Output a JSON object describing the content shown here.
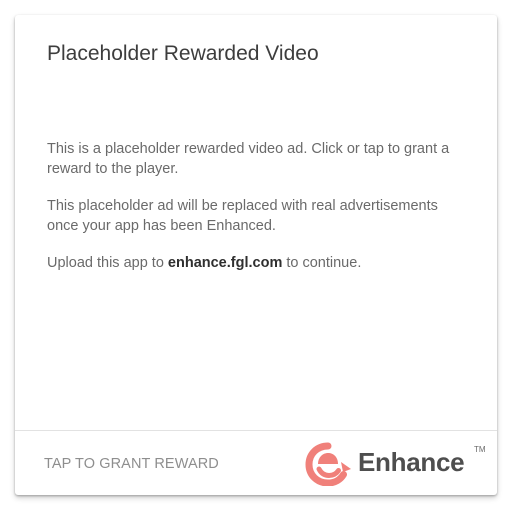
{
  "dialog": {
    "title": "Placeholder Rewarded Video",
    "paragraph_1": "This is a placeholder rewarded video ad. Click or tap to grant a reward to the player.",
    "paragraph_2": "This placeholder ad will be replaced with real advertisements once your app has been Enhanced.",
    "paragraph_3_prefix": "Upload this app to ",
    "paragraph_3_link": "enhance.fgl.com",
    "paragraph_3_suffix": " to continue.",
    "action_label": "TAP TO GRANT REWARD"
  },
  "logo": {
    "wordmark": "Enhance",
    "trademark": "TM",
    "icon": "enhance-logo-icon"
  },
  "colors": {
    "brand_accent": "#f0807a",
    "title_text": "#3d3d3d",
    "body_text": "#6a6a6a",
    "action_text": "#8e8e8e"
  }
}
